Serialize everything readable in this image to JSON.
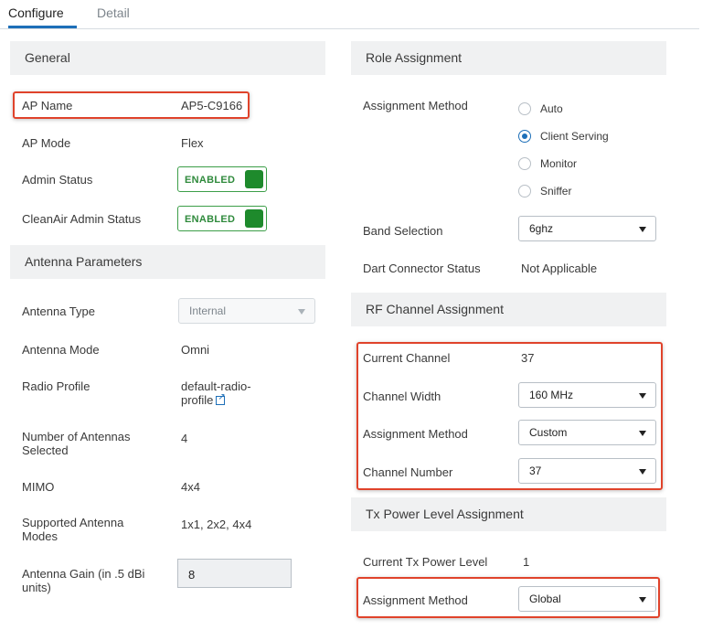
{
  "tabs": {
    "configure": "Configure",
    "detail": "Detail"
  },
  "left": {
    "general_title": "General",
    "ap_name_label": "AP Name",
    "ap_name_value": "AP5-C9166",
    "ap_mode_label": "AP Mode",
    "ap_mode_value": "Flex",
    "admin_status_label": "Admin Status",
    "admin_status_value": "ENABLED",
    "cleanair_label": "CleanAir Admin Status",
    "cleanair_value": "ENABLED",
    "antenna_title": "Antenna Parameters",
    "antenna_type_label": "Antenna Type",
    "antenna_type_value": "Internal",
    "antenna_mode_label": "Antenna Mode",
    "antenna_mode_value": "Omni",
    "radio_profile_label": "Radio Profile",
    "radio_profile_value_1": "default-radio-",
    "radio_profile_value_2": "profile",
    "num_antennas_label_1": "Number of Antennas",
    "num_antennas_label_2": "Selected",
    "num_antennas_value": "4",
    "mimo_label": "MIMO",
    "mimo_value": "4x4",
    "supported_modes_label_1": "Supported Antenna",
    "supported_modes_label_2": "Modes",
    "supported_modes_value": "1x1, 2x2, 4x4",
    "gain_label_1": "Antenna Gain (in .5 dBi",
    "gain_label_2": "units)",
    "gain_value": "8"
  },
  "right": {
    "role_title": "Role Assignment",
    "assignment_method_label": "Assignment Method",
    "radio_options": [
      {
        "label": "Auto",
        "checked": false
      },
      {
        "label": "Client Serving",
        "checked": true
      },
      {
        "label": "Monitor",
        "checked": false
      },
      {
        "label": "Sniffer",
        "checked": false
      }
    ],
    "band_label": "Band Selection",
    "band_value": "6ghz",
    "dart_label": "Dart Connector Status",
    "dart_value": "Not Applicable",
    "rf_title": "RF Channel Assignment",
    "current_channel_label": "Current Channel",
    "current_channel_value": "37",
    "channel_width_label": "Channel Width",
    "channel_width_value": "160 MHz",
    "rf_assignment_label": "Assignment Method",
    "rf_assignment_value": "Custom",
    "channel_number_label": "Channel Number",
    "channel_number_value": "37",
    "tx_title": "Tx Power Level Assignment",
    "tx_current_label": "Current Tx Power Level",
    "tx_current_value": "1",
    "tx_assignment_label": "Assignment Method",
    "tx_assignment_value": "Global"
  },
  "colors": {
    "accent": "#1d6fb8",
    "enabled_green": "#1e8a2c",
    "highlight_red": "#e0432b",
    "section_bg": "#f0f1f2"
  }
}
